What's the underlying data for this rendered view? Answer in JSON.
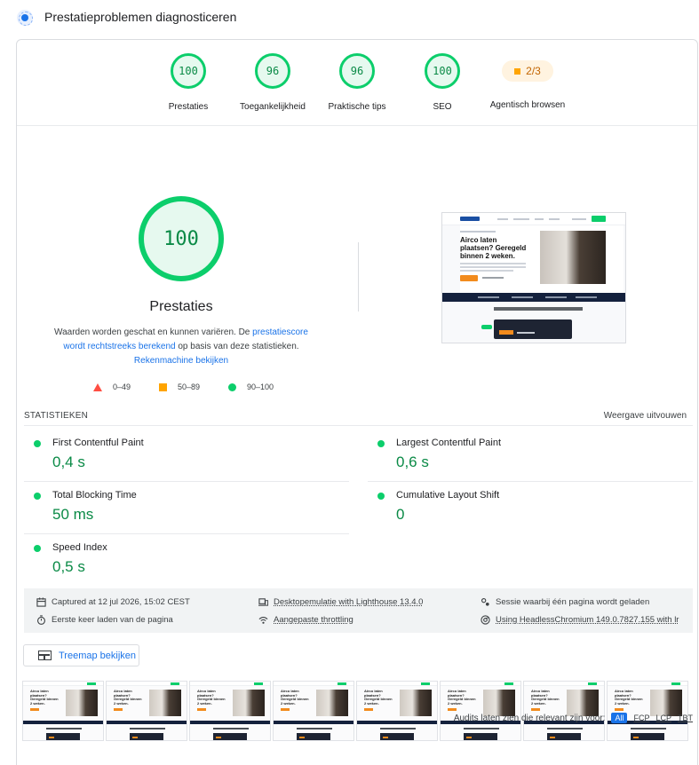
{
  "header": {
    "title": "Prestatieproblemen diagnosticeren",
    "icon": "lighthouse-diagnostic-icon"
  },
  "categories": [
    {
      "score": "100",
      "label": "Prestaties"
    },
    {
      "score": "96",
      "label": "Toegankelijkheid"
    },
    {
      "score": "96",
      "label": "Praktische tips"
    },
    {
      "score": "100",
      "label": "SEO"
    },
    {
      "score": "2/3",
      "label": "Agentisch browsen"
    }
  ],
  "main": {
    "score": "100",
    "title": "Prestaties",
    "desc_prefix": "Waarden worden geschat en kunnen variëren. De ",
    "desc_link1": "prestatiescore wordt rechtstreeks berekend",
    "desc_mid": " op basis van deze statistieken. ",
    "desc_link2": "Rekenmachine bekijken",
    "legend": [
      "0–49",
      "50–89",
      "90–100"
    ]
  },
  "screenshot": {
    "headline": "Airco laten plaatsen? Geregeld binnen 2 weken."
  },
  "stats": {
    "title": "STATISTIEKEN",
    "toggle": "Weergave uitvouwen",
    "metrics": [
      {
        "name": "First Contentful Paint",
        "value": "0,4 s"
      },
      {
        "name": "Largest Contentful Paint",
        "value": "0,6 s"
      },
      {
        "name": "Total Blocking Time",
        "value": "50 ms"
      },
      {
        "name": "Cumulative Layout Shift",
        "value": "0"
      },
      {
        "name": "Speed Index",
        "value": "0,5 s"
      }
    ]
  },
  "environment": {
    "captured": "Captured at 12 jul 2026, 15:02 CEST",
    "first_load": "Eerste keer laden van de pagina",
    "emulation": "Desktopemulatie with Lighthouse 13.4.0",
    "throttling": "Aangepaste throttling",
    "session": "Sessie waarbij één pagina wordt geladen",
    "browser": "Using HeadlessChromium 149.0.7827.155 with lr"
  },
  "treemap": {
    "label": "Treemap bekijken"
  },
  "filmstrip": {
    "frame_headline": "Airco laten plaatsen? Geregeld binnen 2 weken."
  },
  "audits": {
    "label": "Audits laten zien die relevant zijn voor:",
    "filters": [
      "All",
      "FCP",
      "LCP",
      "TBT"
    ]
  },
  "colors": {
    "pass": "#0cce6b",
    "average": "#ffa400",
    "fail": "#ff4e42",
    "link": "#1a73e8"
  }
}
